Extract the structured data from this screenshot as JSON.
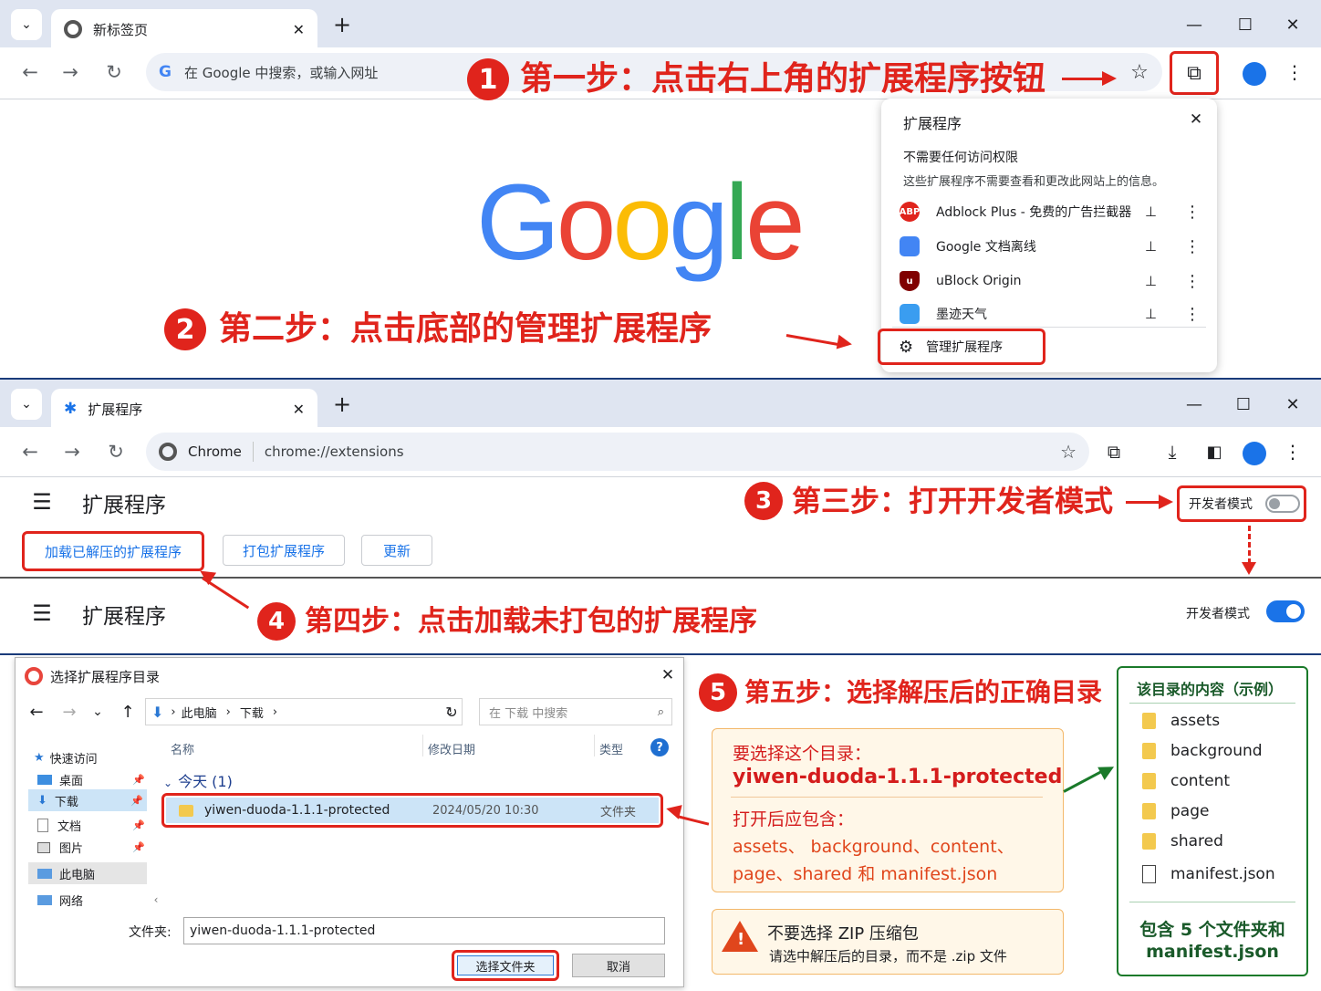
{
  "panel1": {
    "tab_title": "新标签页",
    "omnibox_placeholder": "在 Google 中搜索，或输入网址",
    "step1": "第一步：点击右上角的扩展程序按钮",
    "step2": "第二步：点击底部的管理扩展程序",
    "logo": "Google",
    "popup": {
      "title": "扩展程序",
      "section": "不需要任何访问权限",
      "desc": "这些扩展程序不需要查看和更改此网站上的信息。",
      "items": [
        {
          "name": "Adblock Plus - 免费的广告拦截器",
          "icon": "abp-icon",
          "color": "#e0241c"
        },
        {
          "name": "Google 文档离线",
          "icon": "docs-offline-icon",
          "color": "#4285f4"
        },
        {
          "name": "uBlock Origin",
          "icon": "ublock-icon",
          "color": "#800000"
        },
        {
          "name": "墨迹天气",
          "icon": "weather-icon",
          "color": "#3a9df0"
        }
      ],
      "manage": "管理扩展程序"
    }
  },
  "panel2": {
    "tab_title": "扩展程序",
    "chip": "Chrome",
    "url": "chrome://extensions",
    "page_title": "扩展程序",
    "step3": "第三步：打开开发者模式",
    "dev_mode_label": "开发者模式",
    "dev_mode_off": false,
    "dev_mode_on": true,
    "buttons": [
      "加载已解压的扩展程序",
      "打包扩展程序",
      "更新"
    ],
    "step4": "第四步：点击加载未打包的扩展程序"
  },
  "panel3": {
    "dialog_title": "选择扩展程序目录",
    "path": [
      "此电脑",
      "下载"
    ],
    "search_placeholder": "在 下载 中搜索",
    "sidebar": [
      {
        "label": "快速访问",
        "icon": "star-icon"
      },
      {
        "label": "桌面",
        "icon": "desktop-icon"
      },
      {
        "label": "下载",
        "icon": "download-icon"
      },
      {
        "label": "文档",
        "icon": "document-icon"
      },
      {
        "label": "图片",
        "icon": "picture-icon"
      },
      {
        "label": "此电脑",
        "icon": "computer-icon"
      },
      {
        "label": "网络",
        "icon": "network-icon"
      }
    ],
    "columns": [
      "名称",
      "修改日期",
      "类型"
    ],
    "group": "今天 (1)",
    "row": {
      "name": "yiwen-duoda-1.1.1-protected",
      "date": "2024/05/20 10:30",
      "type": "文件夹"
    },
    "folder_label": "文件夹:",
    "folder_value": "yiwen-duoda-1.1.1-protected",
    "select_btn": "选择文件夹",
    "cancel_btn": "取消",
    "step5": "第五步：选择解压后的正确目录",
    "note": {
      "title": "要选择这个目录：",
      "dir": "yiwen-duoda-1.1.1-protected",
      "contain_title": "打开后应包含：",
      "contain_line1": "assets、 background、content、",
      "contain_line2": "page、shared 和 manifest.json"
    },
    "warn": {
      "title": "不要选择 ZIP 压缩包",
      "desc": "请选中解压后的目录，而不是 .zip 文件"
    },
    "example": {
      "title": "该目录的内容（示例）",
      "items": [
        "assets",
        "background",
        "content",
        "page",
        "shared",
        "manifest.json"
      ],
      "footer1": "包含 5 个文件夹和",
      "footer2": "manifest.json"
    }
  }
}
